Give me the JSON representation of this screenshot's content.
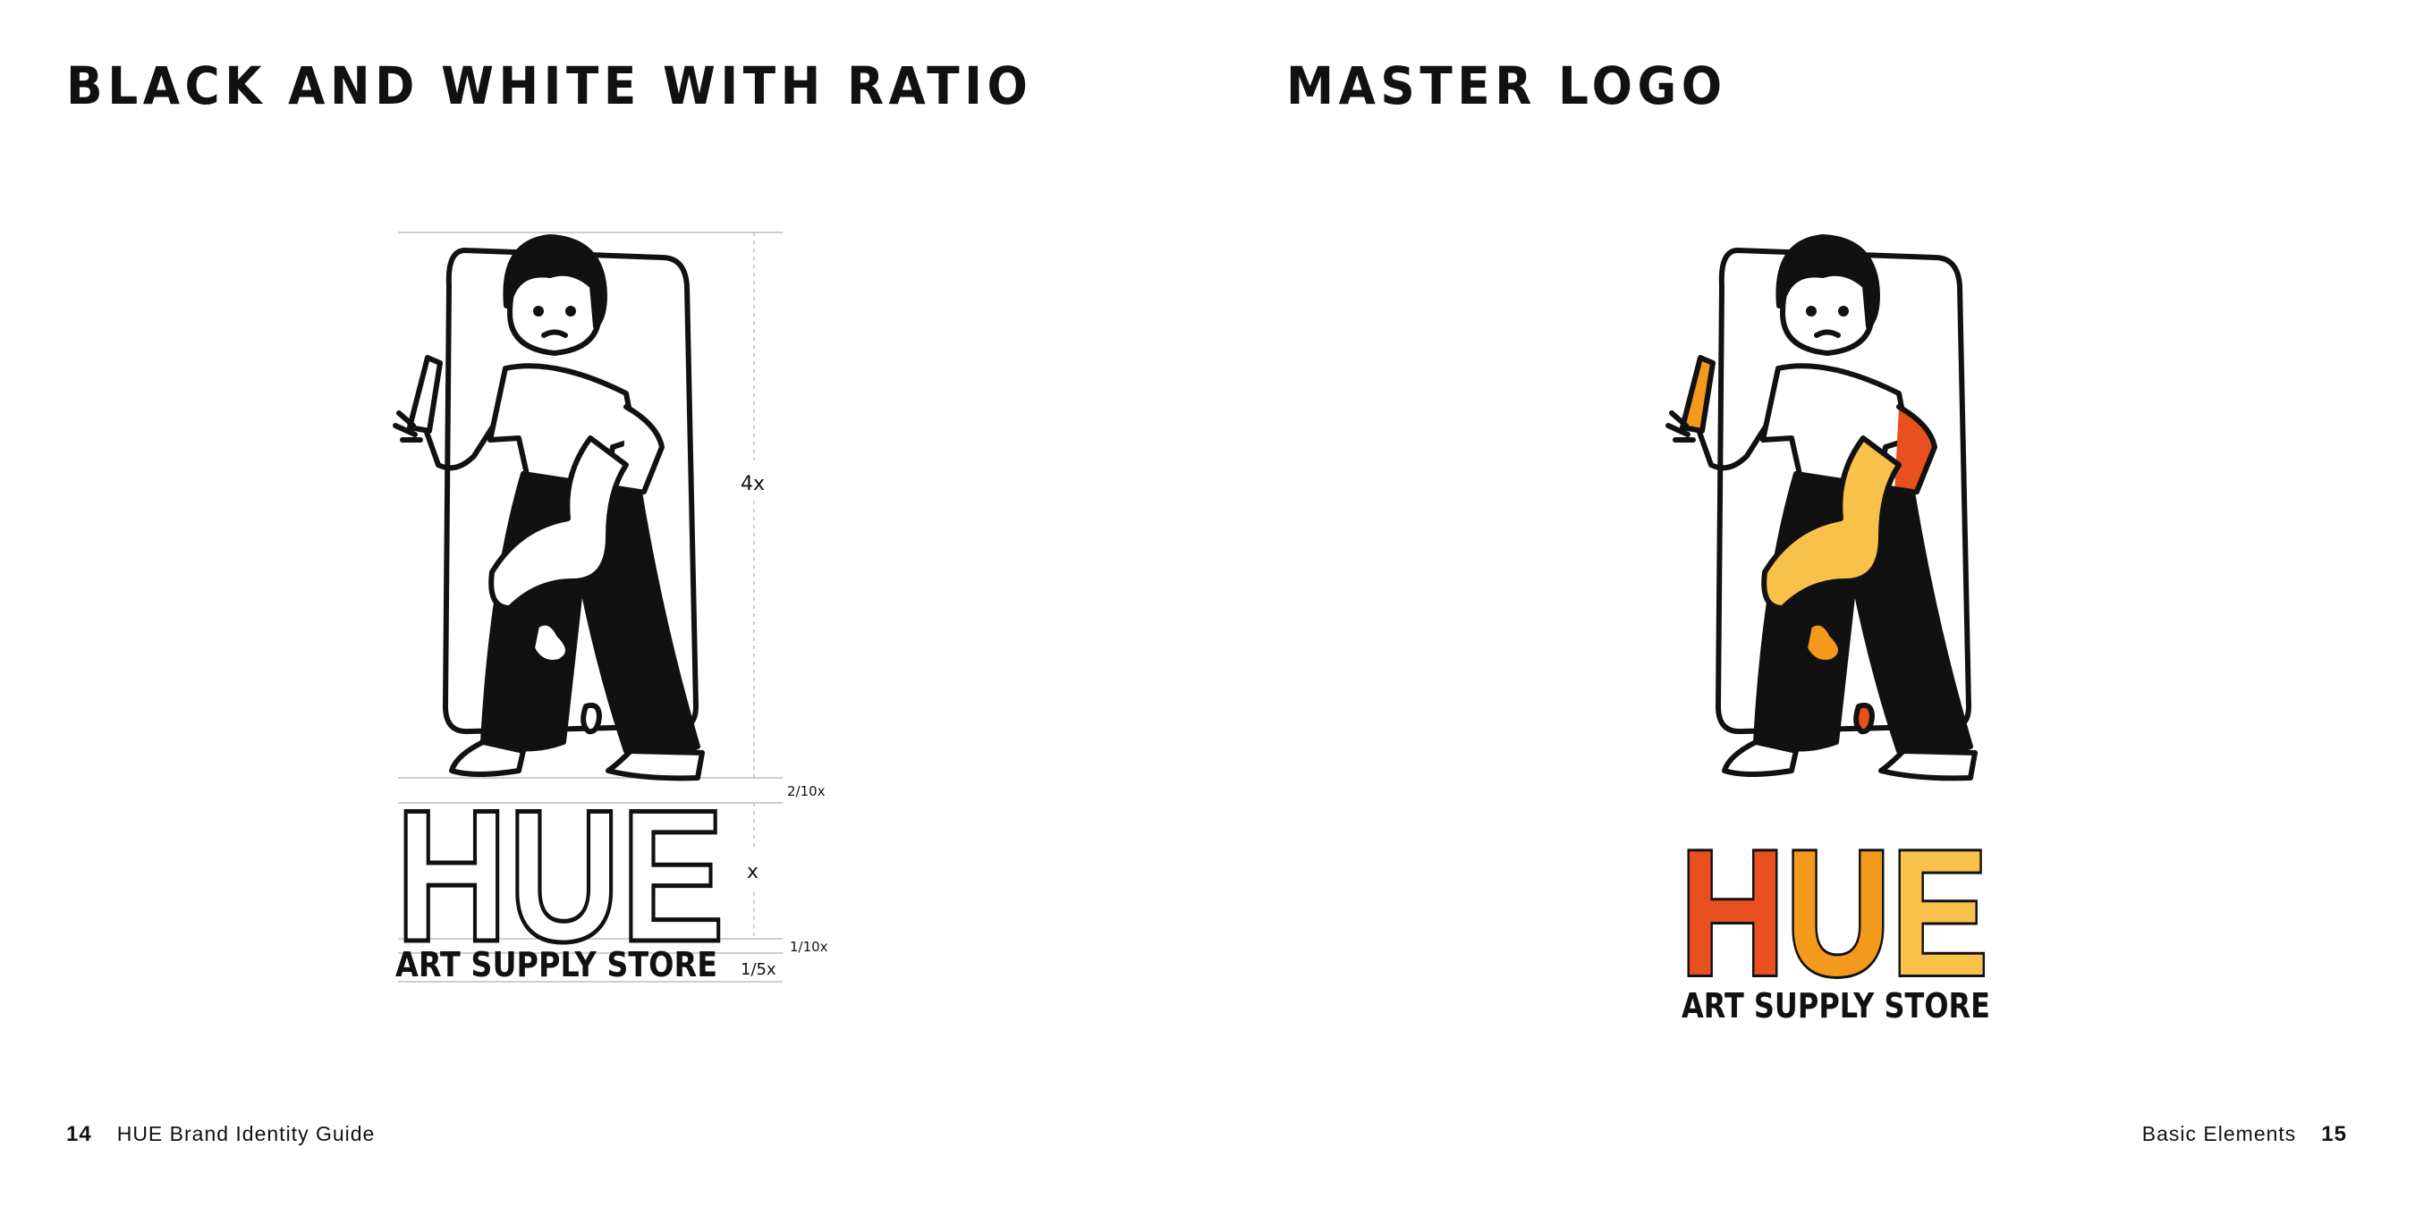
{
  "left_page": {
    "heading": "BLACK AND WHITE WITH RATIO",
    "logo": {
      "wordmark": "HUE",
      "tagline": "ART SUPPLY STORE",
      "style": "black-and-white"
    },
    "ratio_labels": {
      "illustration": "4x",
      "gap_top": "2/10x",
      "wordmark_height": "x",
      "gap_bottom": "1/10x",
      "tagline_height": "1/5x"
    },
    "footer": {
      "page_number": "14",
      "title": "HUE Brand Identity Guide"
    }
  },
  "right_page": {
    "heading": "MASTER LOGO",
    "logo": {
      "wordmark": "HUE",
      "tagline": "ART SUPPLY STORE",
      "style": "color"
    },
    "footer": {
      "section": "Basic Elements",
      "page_number": "15"
    }
  },
  "colors": {
    "ink": "#111111",
    "letter_h": "#e8501f",
    "letter_u": "#f39a1c",
    "letter_e": "#f8c14a",
    "paint_light": "#f8c14a",
    "paint_mid": "#f39a1c",
    "paint_dark": "#e8501f",
    "guide_line": "#bdbdbd"
  }
}
